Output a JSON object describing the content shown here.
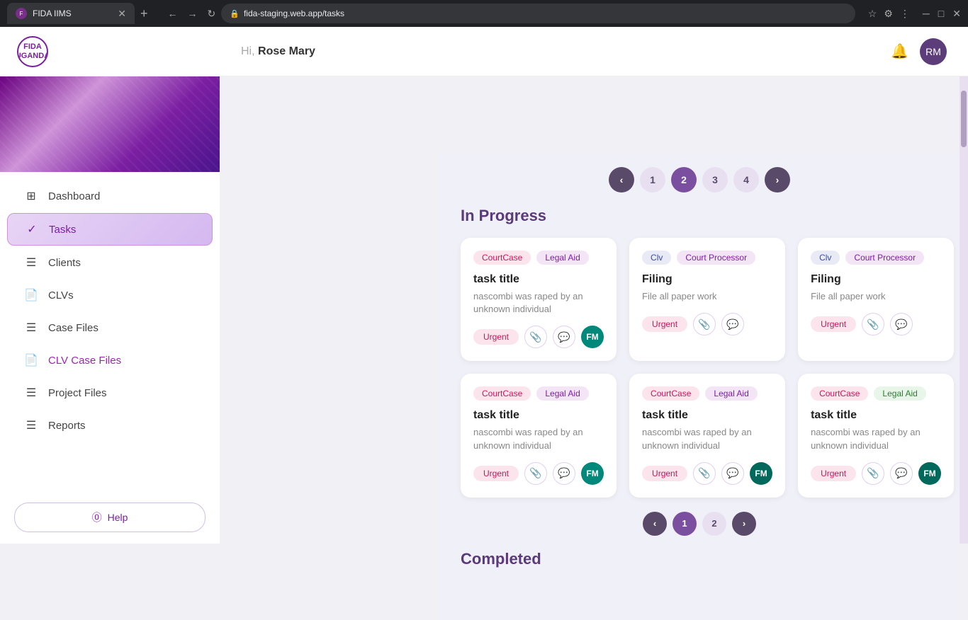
{
  "browser": {
    "tab_title": "FIDA IIMS",
    "url": "fida-staging.web.app/tasks",
    "new_tab_icon": "+"
  },
  "header": {
    "logo_text": "FIDA\nUGANDA",
    "greeting": "Hi,",
    "user_name": "Rose Mary"
  },
  "sidebar": {
    "nav_items": [
      {
        "id": "dashboard",
        "label": "Dashboard",
        "icon": "⊞"
      },
      {
        "id": "tasks",
        "label": "Tasks",
        "icon": "✓",
        "active": true
      },
      {
        "id": "clients",
        "label": "Clients",
        "icon": "≡"
      },
      {
        "id": "clvs",
        "label": "CLVs",
        "icon": "📄"
      },
      {
        "id": "case-files",
        "label": "Case Files",
        "icon": "≡"
      },
      {
        "id": "clv-case-files",
        "label": "CLV Case Files",
        "icon": "📄"
      },
      {
        "id": "project-files",
        "label": "Project Files",
        "icon": "≡"
      },
      {
        "id": "reports",
        "label": "Reports",
        "icon": "≡"
      }
    ],
    "help_label": "Help"
  },
  "main": {
    "top_pagination": {
      "prev_label": "‹",
      "next_label": "›",
      "pages": [
        {
          "num": "1",
          "active": false
        },
        {
          "num": "2",
          "active": true
        },
        {
          "num": "3",
          "active": false
        },
        {
          "num": "4",
          "active": false
        }
      ]
    },
    "in_progress_title": "In Progress",
    "task_cards": [
      {
        "tags": [
          {
            "label": "CourtCase",
            "type": "court-case"
          },
          {
            "label": "Legal Aid",
            "type": "legal-aid"
          }
        ],
        "title": "task title",
        "description": "nascombi was raped by an unknown individual",
        "urgent_label": "Urgent",
        "has_attachment": true,
        "has_comment": true,
        "avatar_initials": "FM",
        "avatar_color": "green"
      },
      {
        "tags": [
          {
            "label": "Clv",
            "type": "clv"
          },
          {
            "label": "Court Processor",
            "type": "court-processor"
          }
        ],
        "title": "Filing",
        "description": "File all paper work",
        "urgent_label": "Urgent",
        "has_attachment": true,
        "has_comment": true,
        "avatar_initials": null,
        "avatar_color": null
      },
      {
        "tags": [
          {
            "label": "Clv",
            "type": "clv"
          },
          {
            "label": "Court Processor",
            "type": "court-processor"
          }
        ],
        "title": "Filing",
        "description": "File all paper work",
        "urgent_label": "Urgent",
        "has_attachment": true,
        "has_comment": true,
        "avatar_initials": null,
        "avatar_color": null
      },
      {
        "tags": [
          {
            "label": "CourtCase",
            "type": "court-case"
          },
          {
            "label": "Legal Aid",
            "type": "legal-aid"
          }
        ],
        "title": "task title",
        "description": "nascombi was raped by an unknown individual",
        "urgent_label": "Urgent",
        "has_attachment": true,
        "has_comment": true,
        "avatar_initials": "FM",
        "avatar_color": "green"
      },
      {
        "tags": [
          {
            "label": "CourtCase",
            "type": "court-case"
          },
          {
            "label": "Legal Aid",
            "type": "legal-aid"
          }
        ],
        "title": "task title",
        "description": "nascombi was raped by an unknown individual",
        "urgent_label": "Urgent",
        "has_attachment": true,
        "has_comment": true,
        "avatar_initials": "FM",
        "avatar_color": "teal"
      },
      {
        "tags": [
          {
            "label": "CourtCase",
            "type": "court-case"
          },
          {
            "label": "Legal Aid",
            "type": "legal-aid-green"
          }
        ],
        "title": "task title",
        "description": "nascombi was raped by an unknown individual",
        "urgent_label": "Urgent",
        "has_attachment": true,
        "has_comment": true,
        "avatar_initials": "FM",
        "avatar_color": "teal"
      }
    ],
    "bottom_pagination": {
      "prev_label": "‹",
      "next_label": "›",
      "pages": [
        {
          "num": "1",
          "active": true
        },
        {
          "num": "2",
          "active": false
        }
      ]
    },
    "completed_title": "Completed"
  }
}
